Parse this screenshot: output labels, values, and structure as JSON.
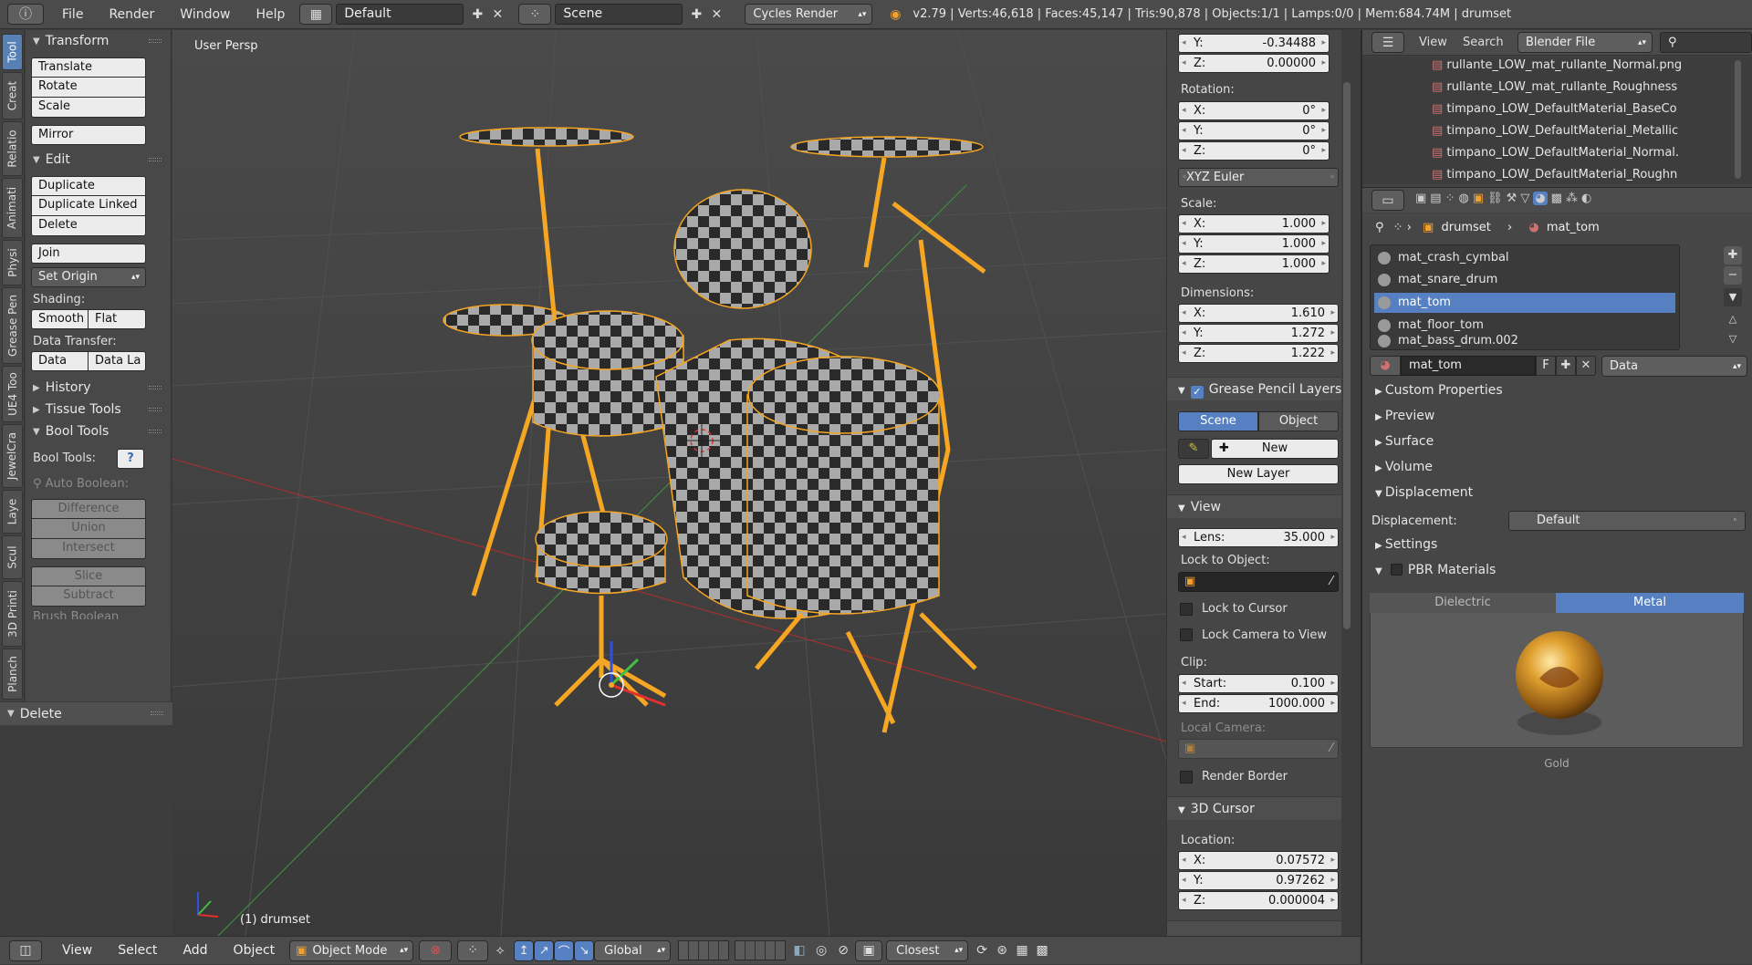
{
  "topbar": {
    "menus": [
      "File",
      "Render",
      "Window",
      "Help"
    ],
    "layout": "Default",
    "scene": "Scene",
    "engine": "Cycles Render",
    "stats": "v2.79 | Verts:46,618 | Faces:45,147 | Tris:90,878 | Objects:1/1 | Lamps:0/0 | Mem:684.74M | drumset"
  },
  "tabs": [
    "Tool",
    "Creat",
    "Relatio",
    "Animati",
    "Physi",
    "Grease Pen",
    "UE4 Too",
    "JewelCra",
    "Laye",
    "Scul",
    "3D Printi",
    "Planch"
  ],
  "toolshelf": {
    "transform": {
      "title": "Transform",
      "buttons": [
        "Translate",
        "Rotate",
        "Scale"
      ],
      "mirror": "Mirror"
    },
    "edit": {
      "title": "Edit",
      "buttons": [
        "Duplicate",
        "Duplicate Linked",
        "Delete"
      ],
      "join": "Join",
      "set_origin": "Set Origin"
    },
    "shading": {
      "label": "Shading:",
      "smooth": "Smooth",
      "flat": "Flat"
    },
    "data_transfer": {
      "label": "Data Transfer:",
      "data": "Data",
      "data_layout": "Data La"
    },
    "collapsed": [
      "History",
      "Tissue Tools"
    ],
    "bool": {
      "title": "Bool Tools",
      "label": "Bool Tools:",
      "auto": "Auto Boolean:",
      "ops1": [
        "Difference",
        "Union",
        "Intersect"
      ],
      "ops2": [
        "Slice",
        "Subtract"
      ],
      "brush": "Brush Boolean"
    },
    "last_op": "Delete"
  },
  "viewport": {
    "label": "User Persp",
    "object_label": "(1) drumset"
  },
  "npanel": {
    "loc_y": {
      "k": "Y:",
      "v": "-0.34488"
    },
    "loc_z": {
      "k": "Z:",
      "v": "0.00000"
    },
    "rotation_label": "Rotation:",
    "rot": [
      {
        "k": "X:",
        "v": "0°"
      },
      {
        "k": "Y:",
        "v": "0°"
      },
      {
        "k": "Z:",
        "v": "0°"
      }
    ],
    "rot_mode": "XYZ Euler",
    "scale_label": "Scale:",
    "scale": [
      {
        "k": "X:",
        "v": "1.000"
      },
      {
        "k": "Y:",
        "v": "1.000"
      },
      {
        "k": "Z:",
        "v": "1.000"
      }
    ],
    "dim_label": "Dimensions:",
    "dim": [
      {
        "k": "X:",
        "v": "1.610"
      },
      {
        "k": "Y:",
        "v": "1.272"
      },
      {
        "k": "Z:",
        "v": "1.222"
      }
    ],
    "gp_title": "Grease Pencil Layers",
    "gp_scene": "Scene",
    "gp_object": "Object",
    "gp_new": "New",
    "gp_new_layer": "New Layer",
    "view_title": "View",
    "lens": {
      "k": "Lens:",
      "v": "35.000"
    },
    "lock_obj": "Lock to Object:",
    "lock_cursor": "Lock to Cursor",
    "lock_camera": "Lock Camera to View",
    "clip": "Clip:",
    "clip_start": {
      "k": "Start:",
      "v": "0.100"
    },
    "clip_end": {
      "k": "End:",
      "v": "1000.000"
    },
    "local_camera": "Local Camera:",
    "render_border": "Render Border",
    "cursor_title": "3D Cursor",
    "cursor_loc": "Location:",
    "cursor": [
      {
        "k": "X:",
        "v": "0.07572"
      },
      {
        "k": "Y:",
        "v": "0.97262"
      },
      {
        "k": "Z:",
        "v": "0.000004"
      }
    ]
  },
  "outliner": {
    "view": "View",
    "search": "Search",
    "mode": "Blender File",
    "items": [
      "rullante_LOW_mat_rullante_Normal.png",
      "rullante_LOW_mat_rullante_Roughness",
      "timpano_LOW_DefaultMaterial_BaseCo",
      "timpano_LOW_DefaultMaterial_Metallic",
      "timpano_LOW_DefaultMaterial_Normal.",
      "timpano_LOW_DefaultMaterial_Roughn"
    ]
  },
  "properties": {
    "breadcrumb_obj": "drumset",
    "breadcrumb_mat": "mat_tom",
    "materials": [
      "mat_crash_cymbal",
      "mat_snare_drum",
      "mat_tom",
      "mat_floor_tom",
      "mat_bass_drum.002"
    ],
    "selected_index": 2,
    "mat_name": "mat_tom",
    "mat_f": "F",
    "link": "Data",
    "sections": [
      "Custom Properties",
      "Preview",
      "Surface",
      "Volume"
    ],
    "displacement_title": "Displacement",
    "displacement_label": "Displacement:",
    "displacement_value": "Default",
    "settings": "Settings",
    "pbr": "PBR Materials",
    "dielectric": "Dielectric",
    "metal": "Metal",
    "preset": "Gold"
  },
  "bottombar": {
    "menus": [
      "View",
      "Select",
      "Add",
      "Object"
    ],
    "mode": "Object Mode",
    "orientation": "Global",
    "snap": "Closest"
  },
  "colors": {
    "accent": "#5680c2",
    "selection": "#f5a623",
    "header": "#4b4b4b"
  }
}
